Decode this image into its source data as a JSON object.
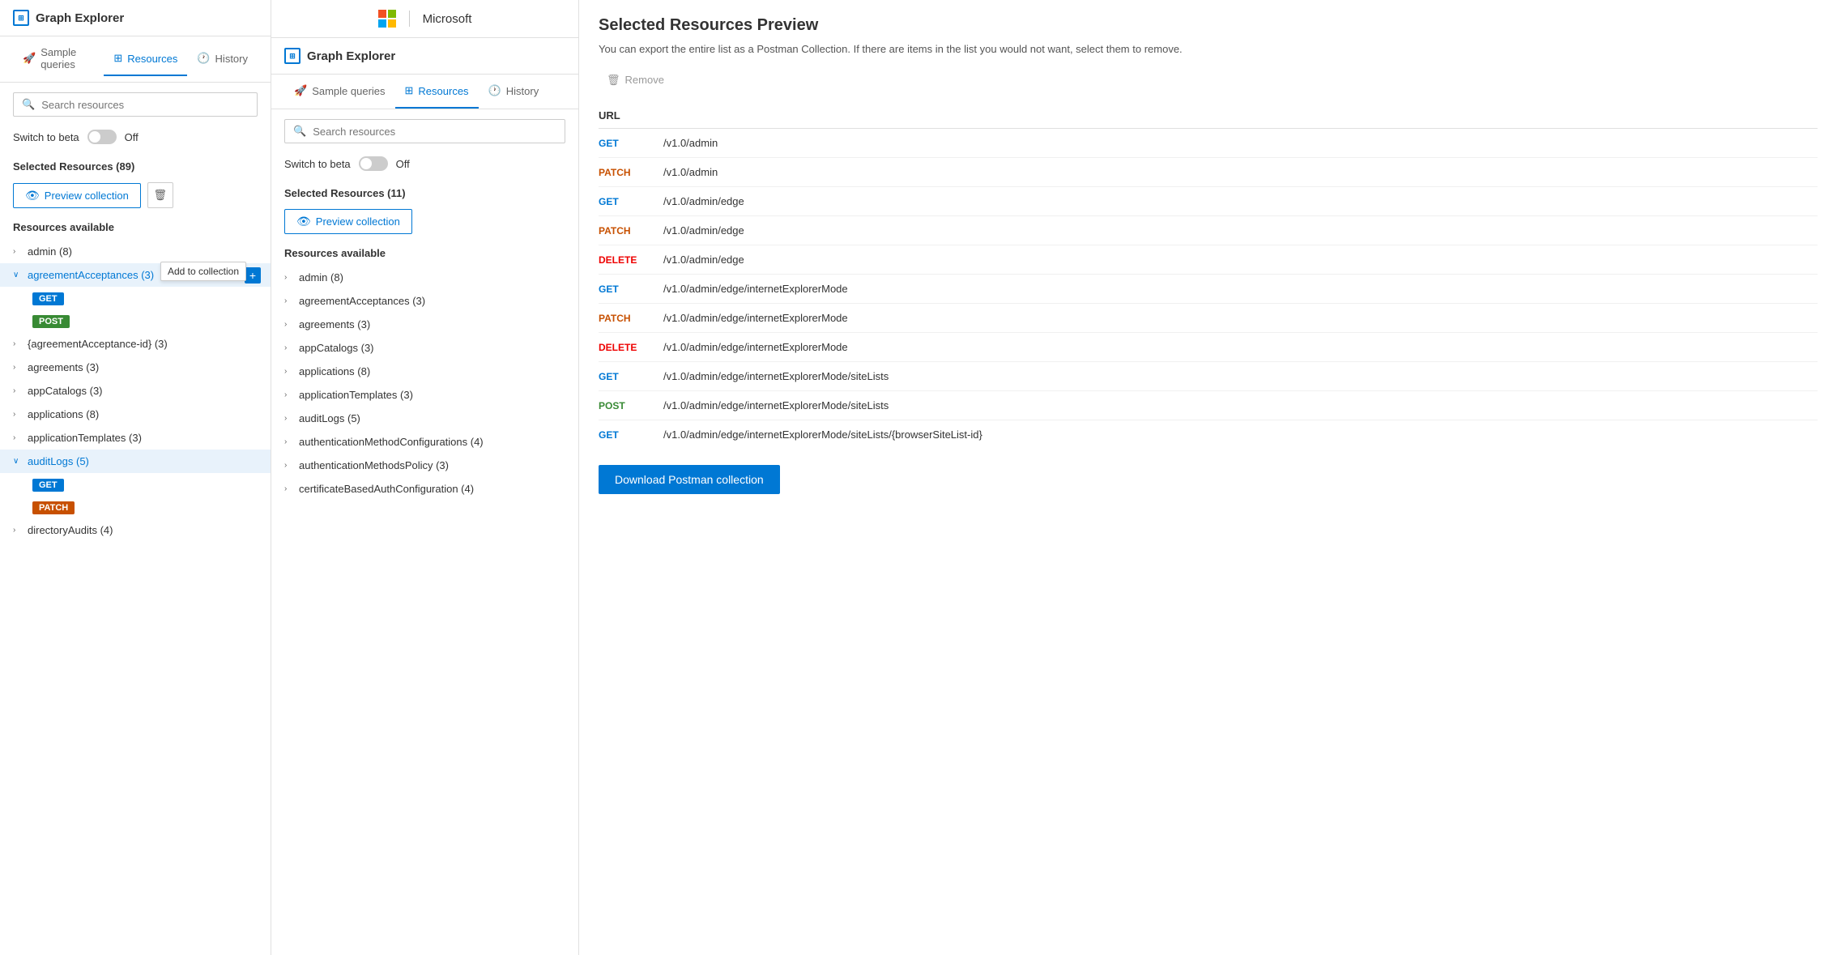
{
  "panel1": {
    "app_title": "Graph Explorer",
    "tabs": [
      {
        "id": "sample-queries",
        "label": "Sample queries",
        "icon": "rocket"
      },
      {
        "id": "resources",
        "label": "Resources",
        "icon": "grid",
        "active": true
      },
      {
        "id": "history",
        "label": "History",
        "icon": "clock"
      }
    ],
    "search": {
      "placeholder": "Search resources"
    },
    "beta": {
      "label": "Switch to beta",
      "state": "Off"
    },
    "selected_resources": {
      "label": "Selected Resources (89)"
    },
    "preview_btn": "Preview collection",
    "resources_available": "Resources available",
    "tooltip": "Add to collection",
    "items": [
      {
        "id": "admin",
        "label": "admin (8)",
        "expanded": false
      },
      {
        "id": "agreementAcceptances",
        "label": "agreementAcceptances (3)",
        "expanded": true,
        "methods": [
          "GET",
          "POST"
        ]
      },
      {
        "id": "agreementAcceptance-id",
        "label": "{agreementAcceptance-id} (3)",
        "expanded": false
      },
      {
        "id": "agreements",
        "label": "agreements (3)",
        "expanded": false
      },
      {
        "id": "appCatalogs",
        "label": "appCatalogs (3)",
        "expanded": false
      },
      {
        "id": "applications",
        "label": "applications (8)",
        "expanded": false
      },
      {
        "id": "applicationTemplates",
        "label": "applicationTemplates (3)",
        "expanded": false
      },
      {
        "id": "auditLogs",
        "label": "auditLogs (5)",
        "expanded": true,
        "methods": [
          "GET",
          "PATCH"
        ]
      },
      {
        "id": "directoryAudits",
        "label": "directoryAudits (4)",
        "expanded": false
      }
    ]
  },
  "panel2": {
    "ms_header": "Microsoft",
    "app_title": "Graph Explorer",
    "tabs": [
      {
        "id": "sample-queries",
        "label": "Sample queries",
        "icon": "rocket"
      },
      {
        "id": "resources",
        "label": "Resources",
        "icon": "grid",
        "active": true
      },
      {
        "id": "history",
        "label": "History",
        "icon": "clock"
      }
    ],
    "search": {
      "placeholder": "Search resources"
    },
    "beta": {
      "label": "Switch to beta",
      "state": "Off"
    },
    "selected_resources": {
      "label": "Selected Resources (11)"
    },
    "preview_btn": "Preview collection",
    "resources_available": "Resources available",
    "items": [
      {
        "id": "admin",
        "label": "admin (8)"
      },
      {
        "id": "agreementAcceptances",
        "label": "agreementAcceptances (3)"
      },
      {
        "id": "agreements",
        "label": "agreements (3)"
      },
      {
        "id": "appCatalogs",
        "label": "appCatalogs (3)"
      },
      {
        "id": "applications",
        "label": "applications (8)"
      },
      {
        "id": "applicationTemplates",
        "label": "applicationTemplates (3)"
      },
      {
        "id": "auditLogs",
        "label": "auditLogs (5)"
      },
      {
        "id": "authenticationMethodConfigurations",
        "label": "authenticationMethodConfigurations (4)"
      },
      {
        "id": "authenticationMethodsPolicy",
        "label": "authenticationMethodsPolicy (3)"
      },
      {
        "id": "certificateBasedAuthConfiguration",
        "label": "certificateBasedAuthConfiguration (4)"
      }
    ]
  },
  "panel3": {
    "title": "Selected Resources Preview",
    "description": "You can export the entire list as a Postman Collection. If there are items in the list you would not want, select them to remove.",
    "remove_btn": "Remove",
    "url_column": "URL",
    "rows": [
      {
        "method": "GET",
        "method_class": "get",
        "path": "/v1.0/admin"
      },
      {
        "method": "PATCH",
        "method_class": "patch",
        "path": "/v1.0/admin"
      },
      {
        "method": "GET",
        "method_class": "get",
        "path": "/v1.0/admin/edge"
      },
      {
        "method": "PATCH",
        "method_class": "patch",
        "path": "/v1.0/admin/edge"
      },
      {
        "method": "DELETE",
        "method_class": "delete",
        "path": "/v1.0/admin/edge"
      },
      {
        "method": "GET",
        "method_class": "get",
        "path": "/v1.0/admin/edge/internetExplorerMode"
      },
      {
        "method": "PATCH",
        "method_class": "patch",
        "path": "/v1.0/admin/edge/internetExplorerMode"
      },
      {
        "method": "DELETE",
        "method_class": "delete",
        "path": "/v1.0/admin/edge/internetExplorerMode"
      },
      {
        "method": "GET",
        "method_class": "get",
        "path": "/v1.0/admin/edge/internetExplorerMode/siteLists"
      },
      {
        "method": "POST",
        "method_class": "post",
        "path": "/v1.0/admin/edge/internetExplorerMode/siteLists"
      },
      {
        "method": "GET",
        "method_class": "get",
        "path": "/v1.0/admin/edge/internetExplorerMode/siteLists/{browserSiteList-id}"
      }
    ],
    "download_btn": "Download Postman collection"
  }
}
